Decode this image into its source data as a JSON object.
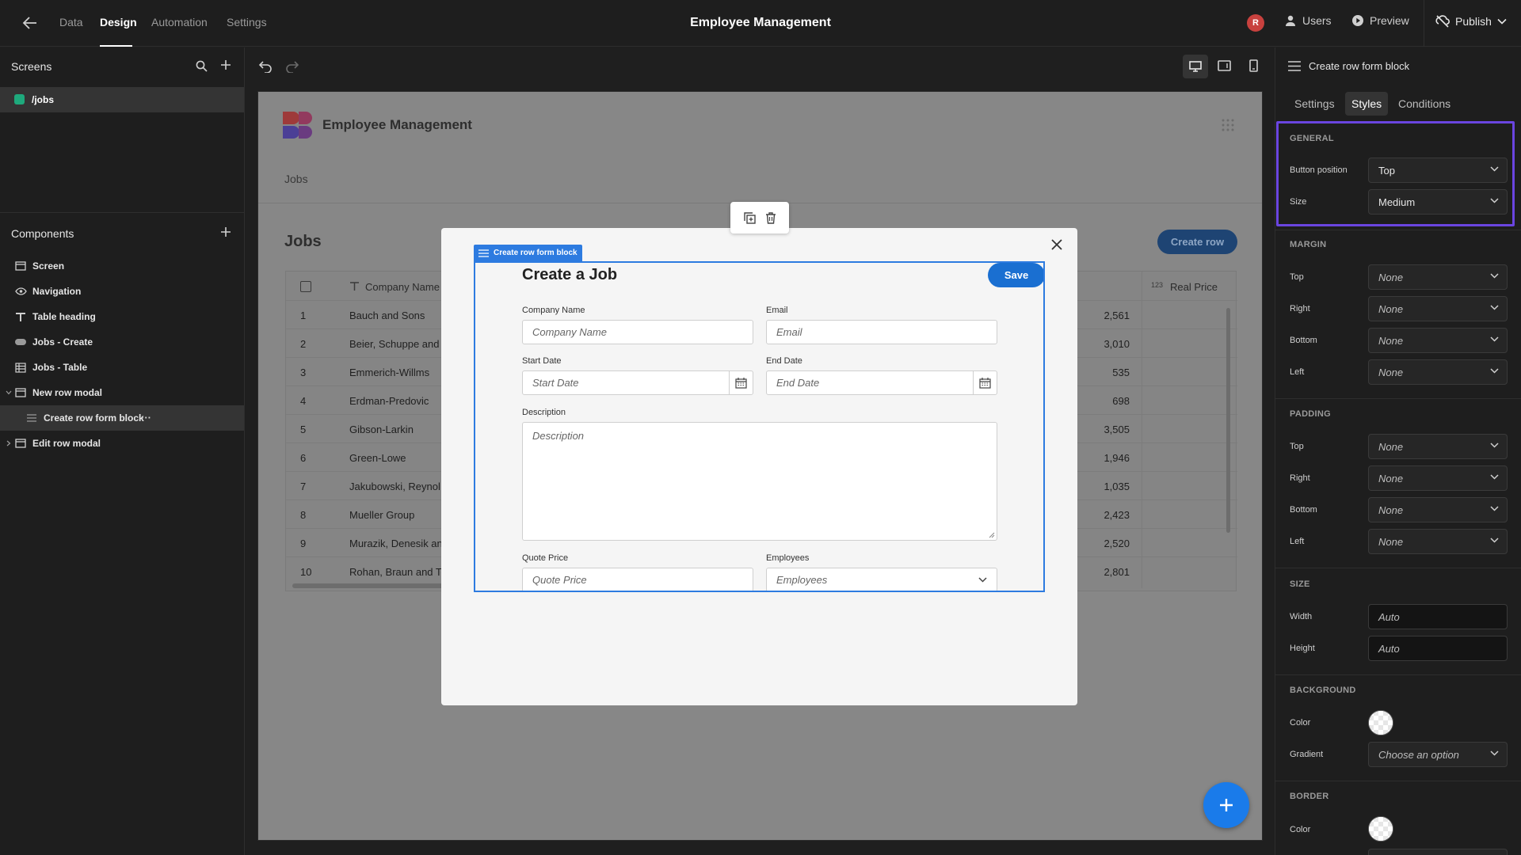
{
  "topbar": {
    "nav": [
      "Data",
      "Design",
      "Automation",
      "Settings"
    ],
    "active_nav": "Design",
    "title": "Employee Management",
    "avatar_initial": "R",
    "users_label": "Users",
    "preview_label": "Preview",
    "publish_label": "Publish"
  },
  "left": {
    "screens_title": "Screens",
    "screen_route": "/jobs",
    "components_title": "Components",
    "components": [
      {
        "label": "Screen",
        "icon": "screen-icon"
      },
      {
        "label": "Navigation",
        "icon": "eye-icon"
      },
      {
        "label": "Table heading",
        "icon": "text-icon"
      },
      {
        "label": "Jobs - Create",
        "icon": "button-icon"
      },
      {
        "label": "Jobs - Table",
        "icon": "table-icon"
      },
      {
        "label": "New row modal",
        "icon": "modal-icon"
      },
      {
        "label": "Create row form block",
        "icon": "form-icon"
      },
      {
        "label": "Edit row modal",
        "icon": "modal-icon"
      }
    ],
    "more_label": "···"
  },
  "preview": {
    "app_name": "Employee Management",
    "nav_link": "Jobs",
    "heading": "Jobs",
    "create_row": "Create row",
    "columns": {
      "company": "Company Name",
      "real_price_prefix": "123",
      "real_price": "Real Price"
    },
    "rows": [
      {
        "n": "1",
        "company": "Bauch and Sons",
        "price": "2,561"
      },
      {
        "n": "2",
        "company": "Beier, Schuppe and I",
        "price": "3,010"
      },
      {
        "n": "3",
        "company": "Emmerich-Willms",
        "price": "535"
      },
      {
        "n": "4",
        "company": "Erdman-Predovic",
        "price": "698"
      },
      {
        "n": "5",
        "company": "Gibson-Larkin",
        "price": "3,505"
      },
      {
        "n": "6",
        "company": "Green-Lowe",
        "price": "1,946"
      },
      {
        "n": "7",
        "company": "Jakubowski, Reynol",
        "price": "1,035"
      },
      {
        "n": "8",
        "company": "Mueller Group",
        "price": "2,423"
      },
      {
        "n": "9",
        "company": "Murazik, Denesik an",
        "price": "2,520"
      },
      {
        "n": "10",
        "company": "Rohan, Braun and Te",
        "price": "2,801"
      }
    ]
  },
  "form": {
    "tag": "Create row form block",
    "title": "Create a Job",
    "save": "Save",
    "company_label": "Company Name",
    "company_placeholder": "Company Name",
    "email_label": "Email",
    "email_placeholder": "Email",
    "start_label": "Start Date",
    "start_placeholder": "Start Date",
    "end_label": "End Date",
    "end_placeholder": "End Date",
    "description_label": "Description",
    "description_placeholder": "Description",
    "quote_label": "Quote Price",
    "quote_placeholder": "Quote Price",
    "employees_label": "Employees",
    "employees_placeholder": "Employees"
  },
  "right": {
    "header": "Create row form block",
    "tabs": [
      "Settings",
      "Styles",
      "Conditions"
    ],
    "active_tab": "Styles",
    "general": {
      "title": "GENERAL",
      "button_position_label": "Button position",
      "button_position": "Top",
      "size_label": "Size",
      "size": "Medium"
    },
    "margin": {
      "title": "MARGIN",
      "top_label": "Top",
      "right_label": "Right",
      "bottom_label": "Bottom",
      "left_label": "Left",
      "top": "None",
      "right": "None",
      "bottom": "None",
      "left": "None"
    },
    "padding": {
      "title": "PADDING",
      "top_label": "Top",
      "right_label": "Right",
      "bottom_label": "Bottom",
      "left_label": "Left",
      "top": "None",
      "right": "None",
      "bottom": "None",
      "left": "None"
    },
    "size": {
      "title": "SIZE",
      "width_label": "Width",
      "height_label": "Height",
      "width": "Auto",
      "height": "Auto"
    },
    "background": {
      "title": "BACKGROUND",
      "color_label": "Color",
      "gradient_label": "Gradient",
      "gradient": "Choose an option"
    },
    "border": {
      "title": "BORDER",
      "color_label": "Color"
    }
  },
  "colors": {
    "accent": "#1a6fd1",
    "highlight": "#6a45e0",
    "screen_dot": "#1ea97c"
  }
}
